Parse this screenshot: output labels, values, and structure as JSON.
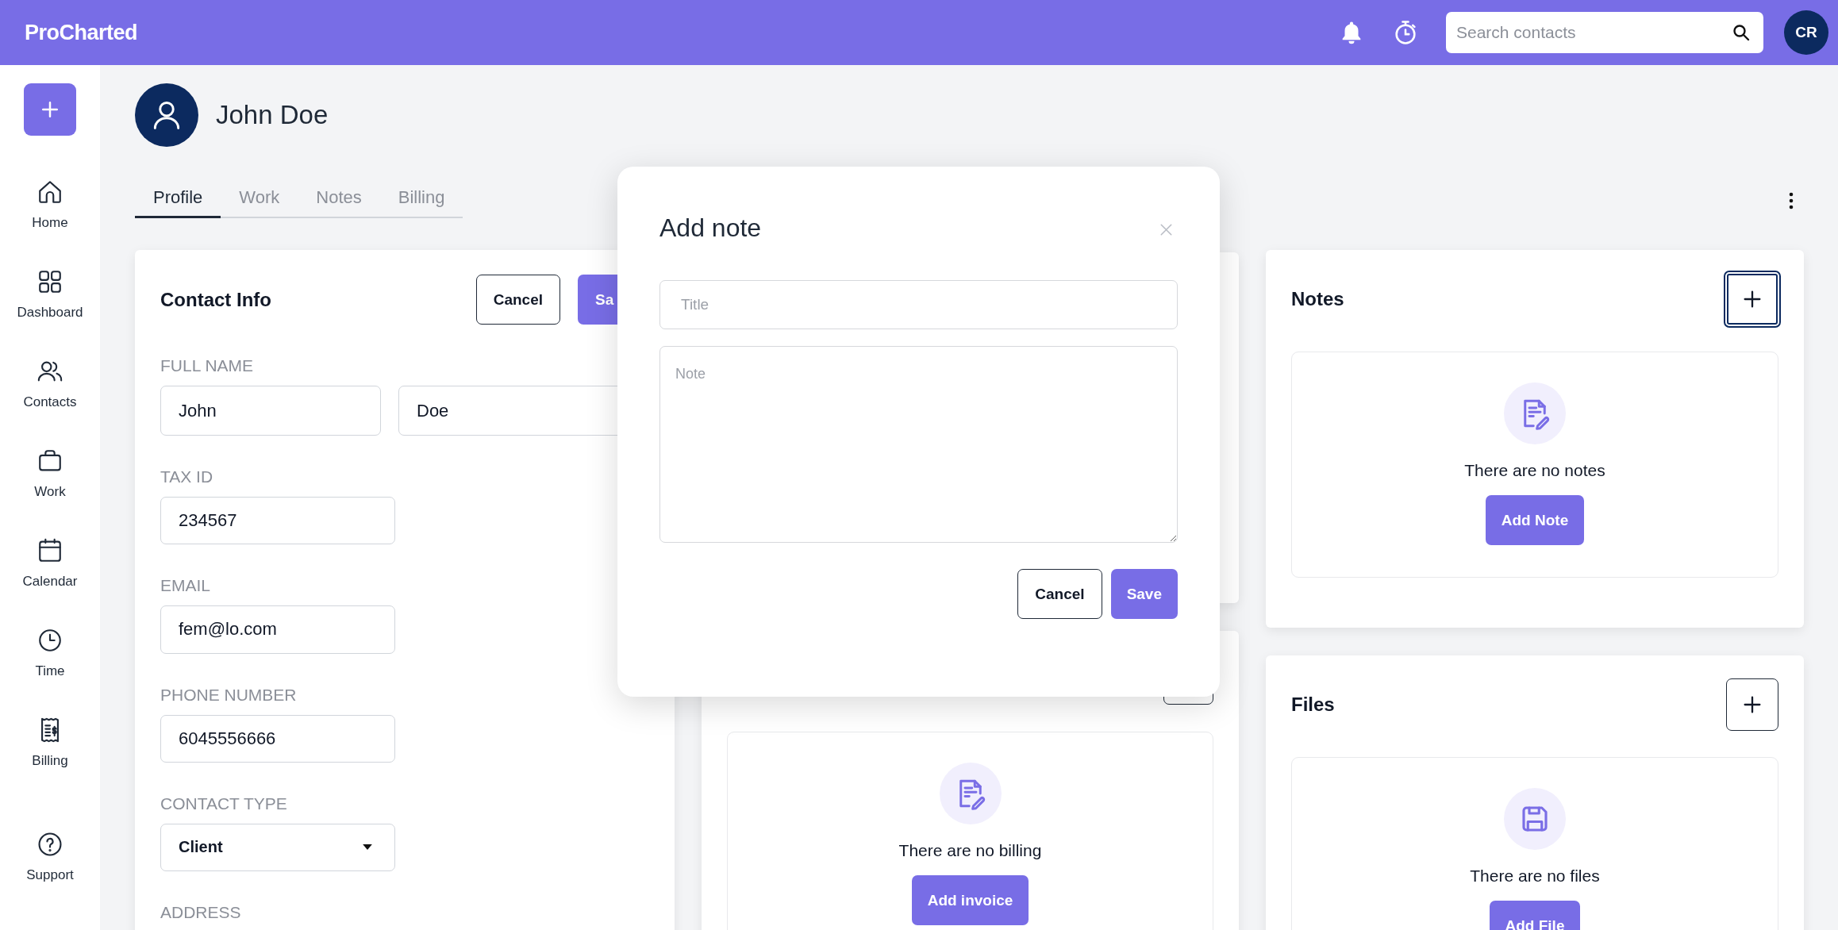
{
  "app": {
    "logo": "ProCharted",
    "search": {
      "placeholder": "Search contacts"
    },
    "user_initials": "CR"
  },
  "sidebar": {
    "items": [
      {
        "label": "Home",
        "kind": "home"
      },
      {
        "label": "Dashboard",
        "kind": "dashboard"
      },
      {
        "label": "Contacts",
        "kind": "contacts"
      },
      {
        "label": "Work",
        "kind": "work"
      },
      {
        "label": "Calendar",
        "kind": "calendar"
      },
      {
        "label": "Time",
        "kind": "time"
      },
      {
        "label": "Billing",
        "kind": "billing"
      }
    ],
    "support": {
      "label": "Support"
    }
  },
  "contact": {
    "name": "John Doe"
  },
  "tabs": [
    {
      "label": "Profile",
      "selected": true
    },
    {
      "label": "Work",
      "selected": false
    },
    {
      "label": "Notes",
      "selected": false
    },
    {
      "label": "Billing",
      "selected": false
    }
  ],
  "contact_info": {
    "title": "Contact Info",
    "cancel": "Cancel",
    "save": "Sa",
    "fields": [
      {
        "label": "FULL NAME",
        "kind": "pair",
        "values": [
          "John",
          "Doe"
        ]
      },
      {
        "label": "TAX ID",
        "kind": "text",
        "values": [
          "234567"
        ]
      },
      {
        "label": "EMAIL",
        "kind": "text",
        "values": [
          "fem@lo.com"
        ]
      },
      {
        "label": "PHONE NUMBER",
        "kind": "text",
        "values": [
          "6045556666"
        ]
      },
      {
        "label": "CONTACT TYPE",
        "kind": "select",
        "values": [
          "Client"
        ]
      }
    ],
    "next_label": "ADDRESS"
  },
  "panels": [
    {
      "kind": "billing",
      "empty_text": "There are no billing",
      "button": "Add invoice"
    },
    {
      "kind": "notes",
      "title": "Notes",
      "add_focused": true,
      "empty_text": "There are no notes",
      "button": "Add Note"
    },
    {
      "kind": "files",
      "title": "Files",
      "add_focused": false,
      "empty_text": "There are no files",
      "button": "Add File"
    }
  ],
  "dialog": {
    "title": "Add note",
    "title_field": {
      "placeholder": "Title"
    },
    "note_field": {
      "placeholder": "Note"
    },
    "buttons": [
      {
        "label": "Cancel",
        "kind": "secondary"
      },
      {
        "label": "Save",
        "kind": "primary"
      }
    ]
  }
}
